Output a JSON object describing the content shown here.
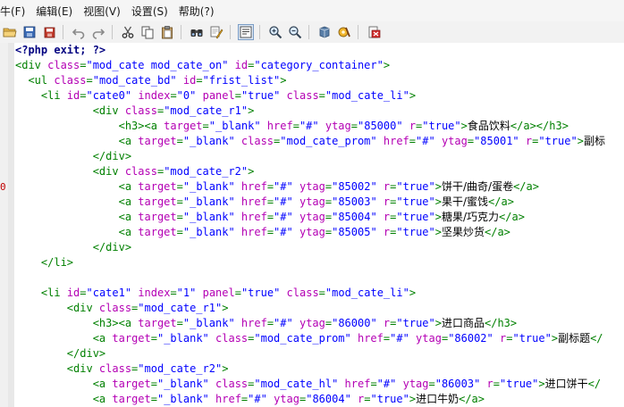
{
  "menu": [
    "牛(F)",
    "编辑(E)",
    "视图(V)",
    "设置(S)",
    "帮助(?)"
  ],
  "toolbar": {
    "icons": [
      "open-folder-icon",
      "save-icon",
      "save-all-icon",
      "undo-icon",
      "redo-icon",
      "cut-icon",
      "copy-icon",
      "paste-icon",
      "find-icon",
      "replace-icon",
      "word-wrap-icon",
      "zoom-in-icon",
      "zoom-out-icon",
      "scheme-icon",
      "tools-icon",
      "exit-icon"
    ]
  },
  "colors": {
    "tag": "#008000",
    "attr": "#b400b4",
    "value": "#0000ff",
    "php": "#000080",
    "marker": "#c00000"
  },
  "code": [
    {
      "indent": "",
      "mark": "",
      "tokens": [
        [
          "php",
          "<?php exit; ?>"
        ]
      ]
    },
    {
      "indent": "",
      "mark": "",
      "tokens": [
        [
          "tag",
          "<div "
        ],
        [
          "attr",
          "class"
        ],
        [
          "tag",
          "="
        ],
        [
          "val",
          "\"mod_cate mod_cate_on\""
        ],
        [
          "tag",
          " "
        ],
        [
          "attr",
          "id"
        ],
        [
          "tag",
          "="
        ],
        [
          "val",
          "\"category_container\""
        ],
        [
          "tag",
          ">"
        ]
      ]
    },
    {
      "indent": "  ",
      "mark": "",
      "tokens": [
        [
          "tag",
          "<ul "
        ],
        [
          "attr",
          "class"
        ],
        [
          "tag",
          "="
        ],
        [
          "val",
          "\"mod_cate_bd\""
        ],
        [
          "tag",
          " "
        ],
        [
          "attr",
          "id"
        ],
        [
          "tag",
          "="
        ],
        [
          "val",
          "\"frist_list\""
        ],
        [
          "tag",
          ">"
        ]
      ]
    },
    {
      "indent": "    ",
      "mark": "",
      "tokens": [
        [
          "tag",
          "<li "
        ],
        [
          "attr",
          "id"
        ],
        [
          "tag",
          "="
        ],
        [
          "val",
          "\"cate0\""
        ],
        [
          "tag",
          " "
        ],
        [
          "attr",
          "index"
        ],
        [
          "tag",
          "="
        ],
        [
          "val",
          "\"0\""
        ],
        [
          "tag",
          " "
        ],
        [
          "attr",
          "panel"
        ],
        [
          "tag",
          "="
        ],
        [
          "val",
          "\"true\""
        ],
        [
          "tag",
          " "
        ],
        [
          "attr",
          "class"
        ],
        [
          "tag",
          "="
        ],
        [
          "val",
          "\"mod_cate_li\""
        ],
        [
          "tag",
          ">"
        ]
      ]
    },
    {
      "indent": "            ",
      "mark": "",
      "tokens": [
        [
          "tag",
          "<div "
        ],
        [
          "attr",
          "class"
        ],
        [
          "tag",
          "="
        ],
        [
          "val",
          "\"mod_cate_r1\""
        ],
        [
          "tag",
          ">"
        ]
      ]
    },
    {
      "indent": "                ",
      "mark": "",
      "tokens": [
        [
          "tag",
          "<h3><a "
        ],
        [
          "attr",
          "target"
        ],
        [
          "tag",
          "="
        ],
        [
          "val",
          "\"_blank\""
        ],
        [
          "tag",
          " "
        ],
        [
          "attr",
          "href"
        ],
        [
          "tag",
          "="
        ],
        [
          "val",
          "\"#\""
        ],
        [
          "tag",
          " "
        ],
        [
          "attr",
          "ytag"
        ],
        [
          "tag",
          "="
        ],
        [
          "val",
          "\"85000\""
        ],
        [
          "tag",
          " "
        ],
        [
          "attr",
          "r"
        ],
        [
          "tag",
          "="
        ],
        [
          "val",
          "\"true\""
        ],
        [
          "tag",
          ">"
        ],
        [
          "txt",
          "食品饮料"
        ],
        [
          "tag",
          "</a></h3>"
        ]
      ]
    },
    {
      "indent": "                ",
      "mark": "",
      "tokens": [
        [
          "tag",
          "<a "
        ],
        [
          "attr",
          "target"
        ],
        [
          "tag",
          "="
        ],
        [
          "val",
          "\"_blank\""
        ],
        [
          "tag",
          " "
        ],
        [
          "attr",
          "class"
        ],
        [
          "tag",
          "="
        ],
        [
          "val",
          "\"mod_cate_prom\""
        ],
        [
          "tag",
          " "
        ],
        [
          "attr",
          "href"
        ],
        [
          "tag",
          "="
        ],
        [
          "val",
          "\"#\""
        ],
        [
          "tag",
          " "
        ],
        [
          "attr",
          "ytag"
        ],
        [
          "tag",
          "="
        ],
        [
          "val",
          "\"85001\""
        ],
        [
          "tag",
          " "
        ],
        [
          "attr",
          "r"
        ],
        [
          "tag",
          "="
        ],
        [
          "val",
          "\"true\""
        ],
        [
          "tag",
          ">"
        ],
        [
          "txt",
          "副标"
        ]
      ]
    },
    {
      "indent": "            ",
      "mark": "",
      "tokens": [
        [
          "tag",
          "</div>"
        ]
      ]
    },
    {
      "indent": "            ",
      "mark": "",
      "tokens": [
        [
          "tag",
          "<div "
        ],
        [
          "attr",
          "class"
        ],
        [
          "tag",
          "="
        ],
        [
          "val",
          "\"mod_cate_r2\""
        ],
        [
          "tag",
          ">"
        ]
      ]
    },
    {
      "indent": "                ",
      "mark": "0",
      "tokens": [
        [
          "tag",
          "<a "
        ],
        [
          "attr",
          "target"
        ],
        [
          "tag",
          "="
        ],
        [
          "val",
          "\"_blank\""
        ],
        [
          "tag",
          " "
        ],
        [
          "attr",
          "href"
        ],
        [
          "tag",
          "="
        ],
        [
          "val",
          "\"#\""
        ],
        [
          "tag",
          " "
        ],
        [
          "attr",
          "ytag"
        ],
        [
          "tag",
          "="
        ],
        [
          "val",
          "\"85002\""
        ],
        [
          "tag",
          " "
        ],
        [
          "attr",
          "r"
        ],
        [
          "tag",
          "="
        ],
        [
          "val",
          "\"true\""
        ],
        [
          "tag",
          ">"
        ],
        [
          "txt",
          "饼干/曲奇/蛋卷"
        ],
        [
          "tag",
          "</a>"
        ]
      ]
    },
    {
      "indent": "                ",
      "mark": "",
      "tokens": [
        [
          "tag",
          "<a "
        ],
        [
          "attr",
          "target"
        ],
        [
          "tag",
          "="
        ],
        [
          "val",
          "\"_blank\""
        ],
        [
          "tag",
          " "
        ],
        [
          "attr",
          "href"
        ],
        [
          "tag",
          "="
        ],
        [
          "val",
          "\"#\""
        ],
        [
          "tag",
          " "
        ],
        [
          "attr",
          "ytag"
        ],
        [
          "tag",
          "="
        ],
        [
          "val",
          "\"85003\""
        ],
        [
          "tag",
          " "
        ],
        [
          "attr",
          "r"
        ],
        [
          "tag",
          "="
        ],
        [
          "val",
          "\"true\""
        ],
        [
          "tag",
          ">"
        ],
        [
          "txt",
          "果干/蜜饯"
        ],
        [
          "tag",
          "</a>"
        ]
      ]
    },
    {
      "indent": "                ",
      "mark": "",
      "tokens": [
        [
          "tag",
          "<a "
        ],
        [
          "attr",
          "target"
        ],
        [
          "tag",
          "="
        ],
        [
          "val",
          "\"_blank\""
        ],
        [
          "tag",
          " "
        ],
        [
          "attr",
          "href"
        ],
        [
          "tag",
          "="
        ],
        [
          "val",
          "\"#\""
        ],
        [
          "tag",
          " "
        ],
        [
          "attr",
          "ytag"
        ],
        [
          "tag",
          "="
        ],
        [
          "val",
          "\"85004\""
        ],
        [
          "tag",
          " "
        ],
        [
          "attr",
          "r"
        ],
        [
          "tag",
          "="
        ],
        [
          "val",
          "\"true\""
        ],
        [
          "tag",
          ">"
        ],
        [
          "txt",
          "糖果/巧克力"
        ],
        [
          "tag",
          "</a>"
        ]
      ]
    },
    {
      "indent": "                ",
      "mark": "",
      "tokens": [
        [
          "tag",
          "<a "
        ],
        [
          "attr",
          "target"
        ],
        [
          "tag",
          "="
        ],
        [
          "val",
          "\"_blank\""
        ],
        [
          "tag",
          " "
        ],
        [
          "attr",
          "href"
        ],
        [
          "tag",
          "="
        ],
        [
          "val",
          "\"#\""
        ],
        [
          "tag",
          " "
        ],
        [
          "attr",
          "ytag"
        ],
        [
          "tag",
          "="
        ],
        [
          "val",
          "\"85005\""
        ],
        [
          "tag",
          " "
        ],
        [
          "attr",
          "r"
        ],
        [
          "tag",
          "="
        ],
        [
          "val",
          "\"true\""
        ],
        [
          "tag",
          ">"
        ],
        [
          "txt",
          "坚果炒货"
        ],
        [
          "tag",
          "</a>"
        ]
      ]
    },
    {
      "indent": "            ",
      "mark": "",
      "tokens": [
        [
          "tag",
          "</div>"
        ]
      ]
    },
    {
      "indent": "    ",
      "mark": "",
      "tokens": [
        [
          "tag",
          "</li>"
        ]
      ]
    },
    {
      "indent": "",
      "mark": "",
      "tokens": []
    },
    {
      "indent": "    ",
      "mark": "",
      "tokens": [
        [
          "tag",
          "<li "
        ],
        [
          "attr",
          "id"
        ],
        [
          "tag",
          "="
        ],
        [
          "val",
          "\"cate1\""
        ],
        [
          "tag",
          " "
        ],
        [
          "attr",
          "index"
        ],
        [
          "tag",
          "="
        ],
        [
          "val",
          "\"1\""
        ],
        [
          "tag",
          " "
        ],
        [
          "attr",
          "panel"
        ],
        [
          "tag",
          "="
        ],
        [
          "val",
          "\"true\""
        ],
        [
          "tag",
          " "
        ],
        [
          "attr",
          "class"
        ],
        [
          "tag",
          "="
        ],
        [
          "val",
          "\"mod_cate_li\""
        ],
        [
          "tag",
          ">"
        ]
      ]
    },
    {
      "indent": "        ",
      "mark": "",
      "tokens": [
        [
          "tag",
          "<div "
        ],
        [
          "attr",
          "class"
        ],
        [
          "tag",
          "="
        ],
        [
          "val",
          "\"mod_cate_r1\""
        ],
        [
          "tag",
          ">"
        ]
      ]
    },
    {
      "indent": "            ",
      "mark": "",
      "tokens": [
        [
          "tag",
          "<h3><a "
        ],
        [
          "attr",
          "target"
        ],
        [
          "tag",
          "="
        ],
        [
          "val",
          "\"_blank\""
        ],
        [
          "tag",
          " "
        ],
        [
          "attr",
          "href"
        ],
        [
          "tag",
          "="
        ],
        [
          "val",
          "\"#\""
        ],
        [
          "tag",
          " "
        ],
        [
          "attr",
          "ytag"
        ],
        [
          "tag",
          "="
        ],
        [
          "val",
          "\"86000\""
        ],
        [
          "tag",
          " "
        ],
        [
          "attr",
          "r"
        ],
        [
          "tag",
          "="
        ],
        [
          "val",
          "\"true\""
        ],
        [
          "tag",
          ">"
        ],
        [
          "txt",
          "进口商品"
        ],
        [
          "tag",
          "</h3>"
        ]
      ]
    },
    {
      "indent": "            ",
      "mark": "",
      "tokens": [
        [
          "tag",
          "<a "
        ],
        [
          "attr",
          "target"
        ],
        [
          "tag",
          "="
        ],
        [
          "val",
          "\"_blank\""
        ],
        [
          "tag",
          " "
        ],
        [
          "attr",
          "class"
        ],
        [
          "tag",
          "="
        ],
        [
          "val",
          "\"mod_cate_prom\""
        ],
        [
          "tag",
          " "
        ],
        [
          "attr",
          "href"
        ],
        [
          "tag",
          "="
        ],
        [
          "val",
          "\"#\""
        ],
        [
          "tag",
          " "
        ],
        [
          "attr",
          "ytag"
        ],
        [
          "tag",
          "="
        ],
        [
          "val",
          "\"86002\""
        ],
        [
          "tag",
          " "
        ],
        [
          "attr",
          "r"
        ],
        [
          "tag",
          "="
        ],
        [
          "val",
          "\"true\""
        ],
        [
          "tag",
          ">"
        ],
        [
          "txt",
          "副标题"
        ],
        [
          "tag",
          "</"
        ]
      ]
    },
    {
      "indent": "        ",
      "mark": "",
      "tokens": [
        [
          "tag",
          "</div>"
        ]
      ]
    },
    {
      "indent": "        ",
      "mark": "",
      "tokens": [
        [
          "tag",
          "<div "
        ],
        [
          "attr",
          "class"
        ],
        [
          "tag",
          "="
        ],
        [
          "val",
          "\"mod_cate_r2\""
        ],
        [
          "tag",
          ">"
        ]
      ]
    },
    {
      "indent": "            ",
      "mark": "",
      "tokens": [
        [
          "tag",
          "<a "
        ],
        [
          "attr",
          "target"
        ],
        [
          "tag",
          "="
        ],
        [
          "val",
          "\"_blank\""
        ],
        [
          "tag",
          " "
        ],
        [
          "attr",
          "class"
        ],
        [
          "tag",
          "="
        ],
        [
          "val",
          "\"mod_cate_hl\""
        ],
        [
          "tag",
          " "
        ],
        [
          "attr",
          "href"
        ],
        [
          "tag",
          "="
        ],
        [
          "val",
          "\"#\""
        ],
        [
          "tag",
          " "
        ],
        [
          "attr",
          "ytag"
        ],
        [
          "tag",
          "="
        ],
        [
          "val",
          "\"86003\""
        ],
        [
          "tag",
          " "
        ],
        [
          "attr",
          "r"
        ],
        [
          "tag",
          "="
        ],
        [
          "val",
          "\"true\""
        ],
        [
          "tag",
          ">"
        ],
        [
          "txt",
          "进口饼干"
        ],
        [
          "tag",
          "</"
        ]
      ]
    },
    {
      "indent": "            ",
      "mark": "",
      "tokens": [
        [
          "tag",
          "<a "
        ],
        [
          "attr",
          "target"
        ],
        [
          "tag",
          "="
        ],
        [
          "val",
          "\"_blank\""
        ],
        [
          "tag",
          " "
        ],
        [
          "attr",
          "href"
        ],
        [
          "tag",
          "="
        ],
        [
          "val",
          "\"#\""
        ],
        [
          "tag",
          " "
        ],
        [
          "attr",
          "ytag"
        ],
        [
          "tag",
          "="
        ],
        [
          "val",
          "\"86004\""
        ],
        [
          "tag",
          " "
        ],
        [
          "attr",
          "r"
        ],
        [
          "tag",
          "="
        ],
        [
          "val",
          "\"true\""
        ],
        [
          "tag",
          ">"
        ],
        [
          "txt",
          "进口牛奶"
        ],
        [
          "tag",
          "</a>"
        ]
      ]
    }
  ]
}
